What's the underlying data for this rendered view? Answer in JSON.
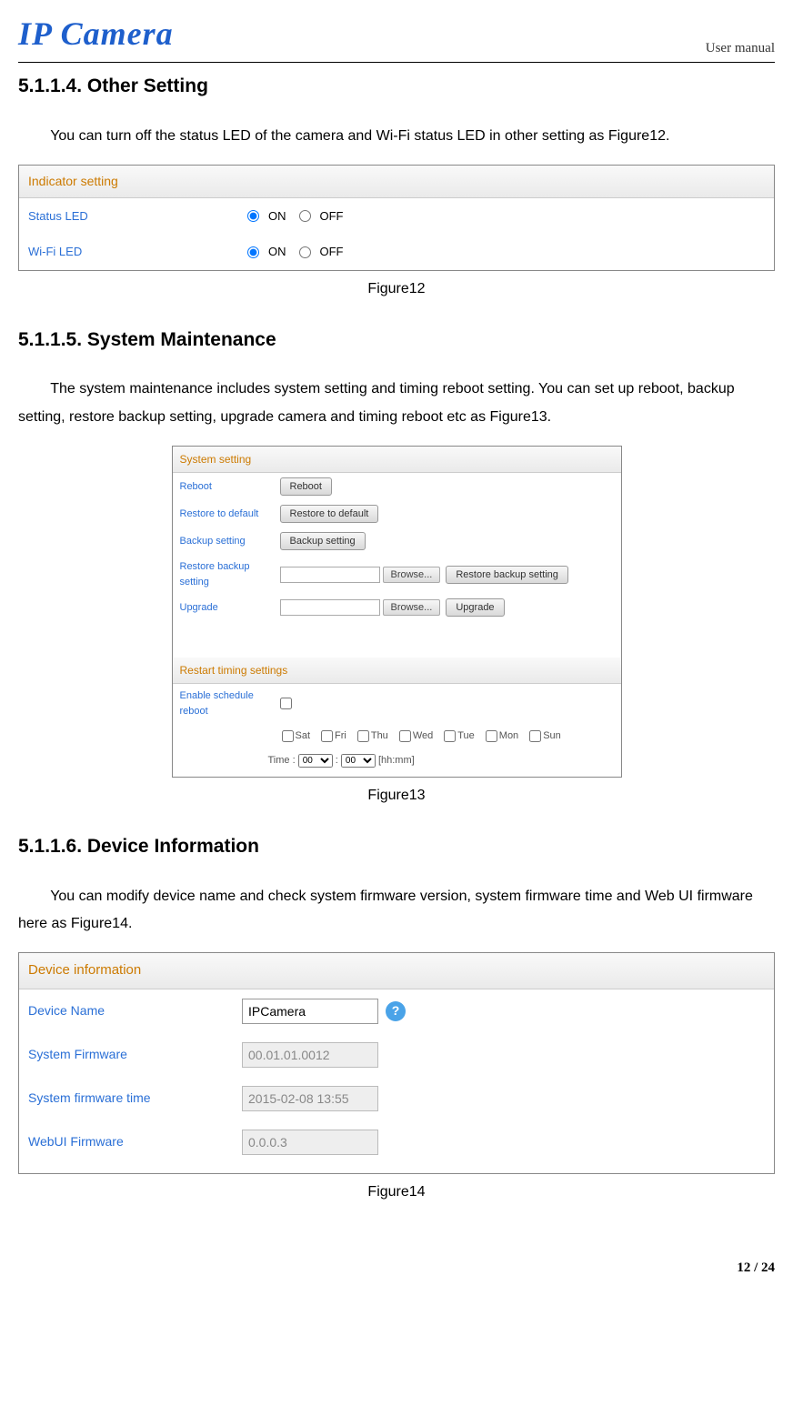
{
  "header": {
    "logo": "IP Camera",
    "label": "User manual"
  },
  "sections": {
    "s4": {
      "heading": "5.1.1.4. Other Setting",
      "body": "You can turn off the status LED of the camera and Wi-Fi status LED in other setting as Figure12."
    },
    "s5": {
      "heading": "5.1.1.5. System Maintenance",
      "body": "The system maintenance includes system setting and timing reboot setting. You can set up reboot, backup setting, restore backup setting, upgrade camera and timing reboot etc as Figure13."
    },
    "s6": {
      "heading": "5.1.1.6. Device Information",
      "body": "You can modify device name and check system firmware version, system firmware time and Web UI firmware here as Figure14."
    }
  },
  "fig12": {
    "panel_title": "Indicator setting",
    "rows": {
      "status_led": "Status LED",
      "wifi_led": "Wi-Fi LED"
    },
    "on": "ON",
    "off": "OFF",
    "caption": "Figure12"
  },
  "fig13": {
    "panel1_title": "System setting",
    "reboot_label": "Reboot",
    "reboot_btn": "Reboot",
    "restore_label": "Restore to default",
    "restore_btn": "Restore to default",
    "backup_label": "Backup setting",
    "backup_btn": "Backup setting",
    "restorebk_label": "Restore backup setting",
    "browse_btn": "Browse...",
    "restorebk_btn": "Restore backup setting",
    "upgrade_label": "Upgrade",
    "upgrade_btn": "Upgrade",
    "panel2_title": "Restart timing settings",
    "enable_label": "Enable schedule reboot",
    "days": {
      "sat": "Sat",
      "fri": "Fri",
      "thu": "Thu",
      "wed": "Wed",
      "tue": "Tue",
      "mon": "Mon",
      "sun": "Sun"
    },
    "time_label": "Time :",
    "hh": "00",
    "mm": "00",
    "hhmm": "[hh:mm]",
    "caption": "Figure13"
  },
  "fig14": {
    "panel_title": "Device information",
    "device_name_label": "Device Name",
    "device_name_value": "IPCamera",
    "sys_fw_label": "System Firmware",
    "sys_fw_value": "00.01.01.0012",
    "sys_time_label": "System firmware time",
    "sys_time_value": "2015-02-08 13:55",
    "webui_label": "WebUI Firmware",
    "webui_value": "0.0.0.3",
    "caption": "Figure14"
  },
  "footer": {
    "page": "12 / 24"
  }
}
